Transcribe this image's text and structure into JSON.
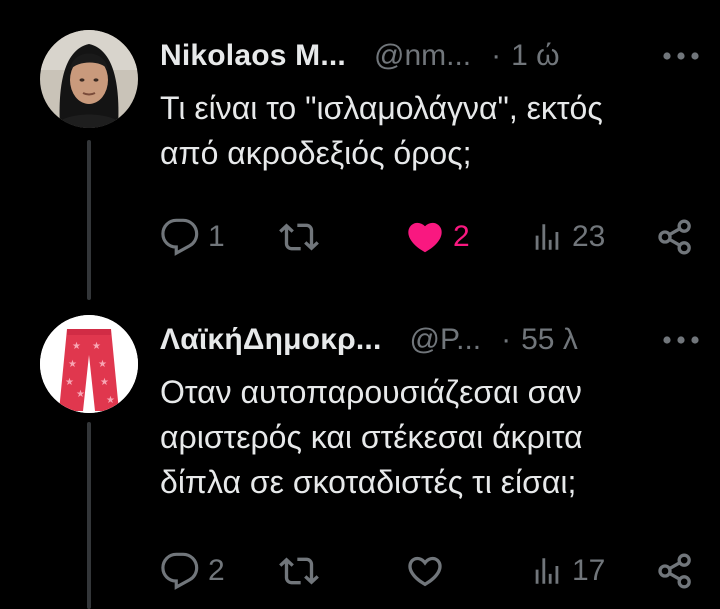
{
  "colors": {
    "background": "#000000",
    "text_primary": "#e7e9ea",
    "text_secondary": "#71767b",
    "like_active": "#f91880",
    "thread_line": "#333639"
  },
  "tweets": [
    {
      "display_name": "Nikolaos M...",
      "handle": "@nm...",
      "separator": "·",
      "time": "1 ώ",
      "more": "•••",
      "text": "Τι είναι το \"ισλαμολάγνα\", εκτός\nαπό ακροδεξιός όρος;",
      "replies": "1",
      "retweets": "",
      "likes": "2",
      "liked": true,
      "views": "23",
      "icons": [
        "reply-icon",
        "retweet-icon",
        "heart-filled-icon",
        "views-icon",
        "share-icon"
      ]
    },
    {
      "display_name": "ΛαϊκήΔημοκρ...",
      "handle": "@P...",
      "separator": "·",
      "time": "55 λ",
      "more": "•••",
      "text": "Οταν αυτοπαρουσιάζεσαι σαν\nαριστερός και στέκεσαι άκριτα\nδίπλα σε σκοταδιστές τι είσαι;",
      "replies": "2",
      "retweets": "",
      "likes": "",
      "liked": false,
      "views": "17",
      "icons": [
        "reply-icon",
        "retweet-icon",
        "heart-outline-icon",
        "views-icon",
        "share-icon"
      ]
    }
  ]
}
